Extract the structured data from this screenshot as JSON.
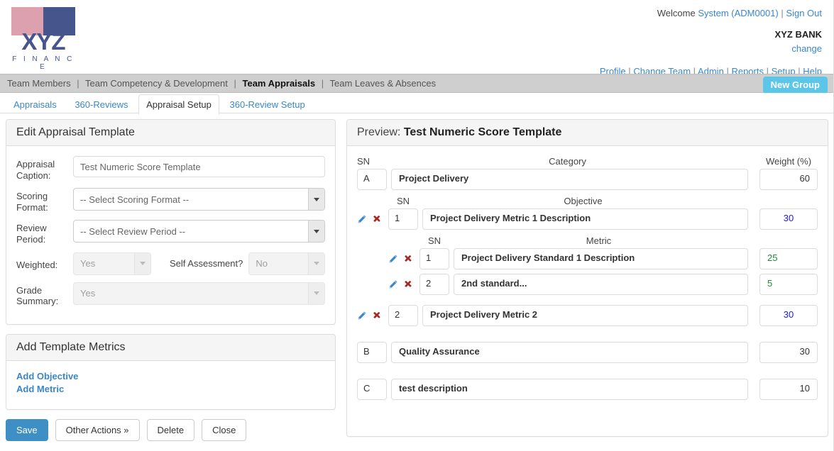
{
  "header": {
    "logo": {
      "wordmark": "XYZ",
      "subtext": "F I N A N C E"
    },
    "welcome_prefix": "Welcome",
    "user": "System (ADM0001)",
    "sign_out": "Sign Out",
    "bank": "XYZ BANK",
    "change": "change",
    "links": [
      "Profile",
      "Change Team",
      "Admin",
      "Reports",
      "Setup",
      "Help"
    ]
  },
  "nav": {
    "items": [
      {
        "label": "Team Members",
        "active": false
      },
      {
        "label": "Team Competency & Development",
        "active": false
      },
      {
        "label": "Team Appraisals",
        "active": true
      },
      {
        "label": "Team Leaves & Absences",
        "active": false
      }
    ],
    "new_group_label": "New Group"
  },
  "tabs": [
    {
      "label": "Appraisals",
      "active": false
    },
    {
      "label": "360-Reviews",
      "active": false
    },
    {
      "label": "Appraisal Setup",
      "active": true
    },
    {
      "label": "360-Review Setup",
      "active": false
    }
  ],
  "edit_panel": {
    "title": "Edit Appraisal Template",
    "fields": {
      "caption_label": "Appraisal Caption:",
      "caption_value": "Test Numeric Score Template",
      "scoring_label": "Scoring Format:",
      "scoring_value": "-- Select Scoring Format --",
      "review_label": "Review Period:",
      "review_value": "-- Select Review Period --",
      "weighted_label": "Weighted:",
      "weighted_value": "Yes",
      "self_assessment_label": "Self Assessment?",
      "self_assessment_value": "No",
      "grade_label": "Grade Summary:",
      "grade_value": "Yes"
    }
  },
  "metrics_panel": {
    "title": "Add Template Metrics",
    "add_objective": "Add Objective",
    "add_metric": "Add Metric"
  },
  "actions": {
    "save": "Save",
    "other_actions": "Other Actions »",
    "delete": "Delete",
    "close": "Close"
  },
  "preview": {
    "label": "Preview:",
    "title": "Test Numeric Score Template",
    "headers": {
      "sn": "SN",
      "category": "Category",
      "objective": "Objective",
      "metric": "Metric",
      "weight": "Weight (%)"
    },
    "rows": [
      {
        "level": "category",
        "sn": "A",
        "name": "Project Delivery",
        "weight": "60",
        "children": [
          {
            "level": "objective",
            "sn": "1",
            "name": "Project Delivery Metric 1 Description",
            "weight": "30",
            "children": [
              {
                "level": "metric",
                "sn": "1",
                "name": "Project Delivery Standard 1 Description",
                "weight": "25"
              },
              {
                "level": "metric",
                "sn": "2",
                "name": "2nd standard...",
                "weight": "5"
              }
            ]
          },
          {
            "level": "objective",
            "sn": "2",
            "name": "Project Delivery Metric 2",
            "weight": "30",
            "children": []
          }
        ]
      },
      {
        "level": "category",
        "sn": "B",
        "name": "Quality Assurance",
        "weight": "30",
        "children": []
      },
      {
        "level": "category",
        "sn": "C",
        "name": "test description",
        "weight": "10",
        "children": []
      }
    ]
  },
  "colors": {
    "brand_blue": "#46558c",
    "brand_pink": "#dda0ae",
    "link": "#3a87c8",
    "primary_button": "#3d8fc6",
    "new_group": "#5bc6e8",
    "objective_weight": "#1a1aee",
    "metric_weight": "#1f8a3a",
    "edit_icon": "#3a87c8",
    "delete_icon": "#a82828"
  }
}
